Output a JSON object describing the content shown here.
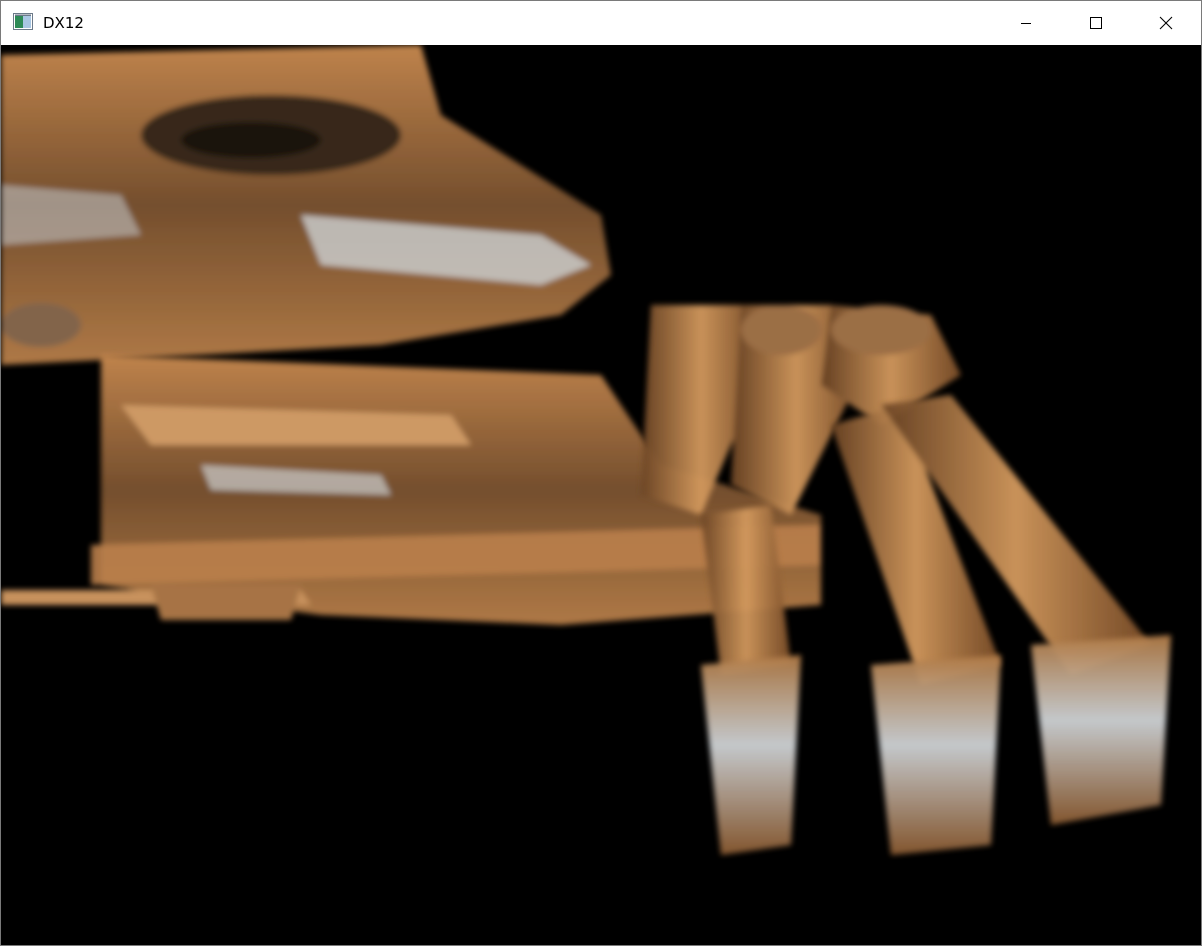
{
  "window": {
    "title": "DX12"
  },
  "icons": {
    "app": "dx12-app-icon",
    "minimize": "minimize-icon",
    "maximize": "maximize-icon",
    "close": "close-icon"
  },
  "colors": {
    "titlebar_bg": "#ffffff",
    "viewport_bg": "#000000",
    "model_primary": "#c8884f",
    "model_shadow": "#6b4424",
    "model_highlight": "#e0e4e8"
  }
}
